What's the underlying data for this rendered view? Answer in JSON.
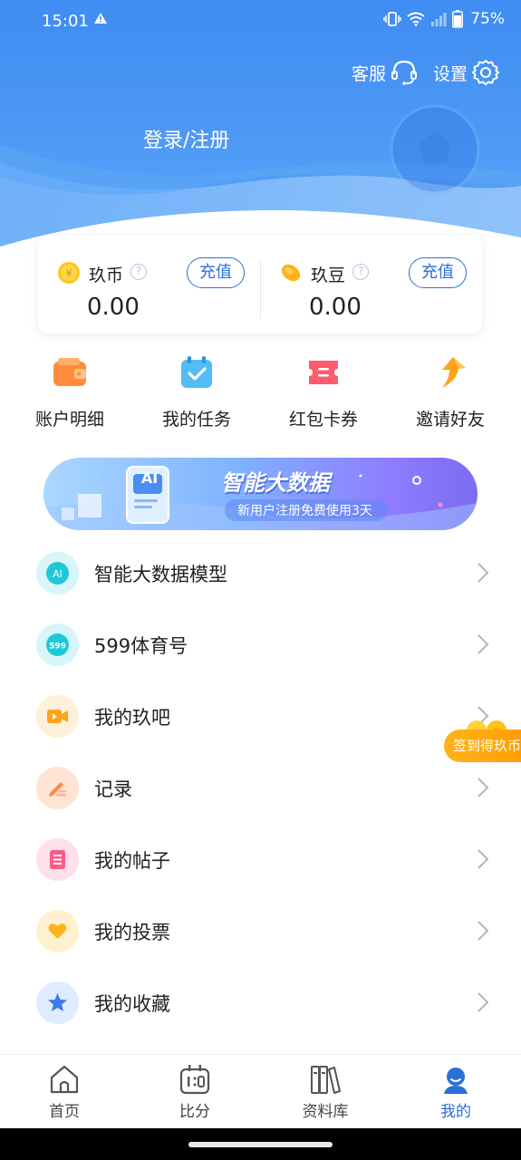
{
  "status_bar": {
    "time": "15:01",
    "battery": "75%"
  },
  "header": {
    "service_label": "客服",
    "settings_label": "设置",
    "login_label": "登录/注册"
  },
  "wallet": {
    "coins": {
      "name": "玖币",
      "amount": "0.00",
      "recharge_label": "充值",
      "help": "?"
    },
    "beans": {
      "name": "玖豆",
      "amount": "0.00",
      "recharge_label": "充值",
      "help": "?"
    }
  },
  "quick_actions": [
    {
      "label": "账户明细",
      "icon": "wallet-icon"
    },
    {
      "label": "我的任务",
      "icon": "task-icon"
    },
    {
      "label": "红包卡券",
      "icon": "coupon-icon"
    },
    {
      "label": "邀请好友",
      "icon": "invite-icon"
    }
  ],
  "banner": {
    "title": "智能大数据",
    "subtitle": "新用户注册免费使用3天",
    "badge": "AI"
  },
  "menu": [
    {
      "label": "智能大数据模型",
      "icon": "ai-icon",
      "icon_text": "AI",
      "color": "#1ec8d8"
    },
    {
      "label": "599体育号",
      "icon": "sports-599-icon",
      "icon_text": "599",
      "color": "#1ec8d8"
    },
    {
      "label": "我的玖吧",
      "icon": "video-icon",
      "color": "#ffa31a"
    },
    {
      "label": "记录",
      "icon": "edit-icon",
      "color": "#ff8a4a"
    },
    {
      "label": "我的帖子",
      "icon": "post-icon",
      "color": "#ff5a86"
    },
    {
      "label": "我的投票",
      "icon": "heart-icon",
      "color": "#ffb21a"
    },
    {
      "label": "我的收藏",
      "icon": "star-icon",
      "color": "#3d7be8"
    }
  ],
  "checkin": {
    "label": "签到得玖币"
  },
  "tabs": [
    {
      "label": "首页",
      "icon": "home-icon",
      "active": false
    },
    {
      "label": "比分",
      "icon": "score-icon",
      "active": false
    },
    {
      "label": "资料库",
      "icon": "library-icon",
      "active": false
    },
    {
      "label": "我的",
      "icon": "profile-icon",
      "active": true
    }
  ],
  "colors": {
    "primary": "#2a6fd8",
    "header_top": "#3f8cf3",
    "header_bottom": "#a9d0fb"
  }
}
